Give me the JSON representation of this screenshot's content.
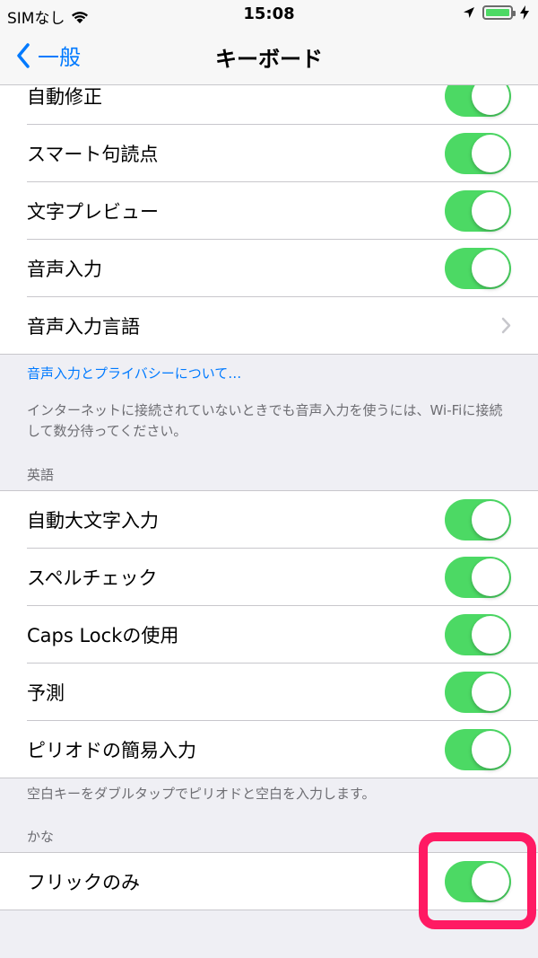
{
  "status_bar": {
    "carrier": "SIMなし",
    "time": "15:08",
    "battery_level": 1.0
  },
  "nav": {
    "back_label": "一般",
    "title": "キーボード"
  },
  "group1": {
    "items": [
      {
        "label": "自動修正",
        "on": true
      },
      {
        "label": "スマート句読点",
        "on": true
      },
      {
        "label": "文字プレビュー",
        "on": true
      },
      {
        "label": "音声入力",
        "on": true
      },
      {
        "label": "音声入力言語"
      }
    ]
  },
  "dictation_footer": {
    "link": "音声入力とプライバシーについて…",
    "note": "インターネットに接続されていないときでも音声入力を使うには、Wi-Fiに接続して数分待ってください。"
  },
  "english": {
    "header": "英語",
    "items": [
      {
        "label": "自動大文字入力",
        "on": true
      },
      {
        "label": "スペルチェック",
        "on": true
      },
      {
        "label": "Caps Lockの使用",
        "on": true
      },
      {
        "label": "予測",
        "on": true
      },
      {
        "label": "ピリオドの簡易入力",
        "on": true
      }
    ],
    "footer": "空白キーをダブルタップでピリオドと空白を入力します。"
  },
  "kana": {
    "header": "かな",
    "items": [
      {
        "label": "フリックのみ",
        "on": true
      }
    ]
  },
  "colors": {
    "accent": "#007aff",
    "toggle_on": "#4cd964",
    "highlight": "#ff1a63"
  }
}
